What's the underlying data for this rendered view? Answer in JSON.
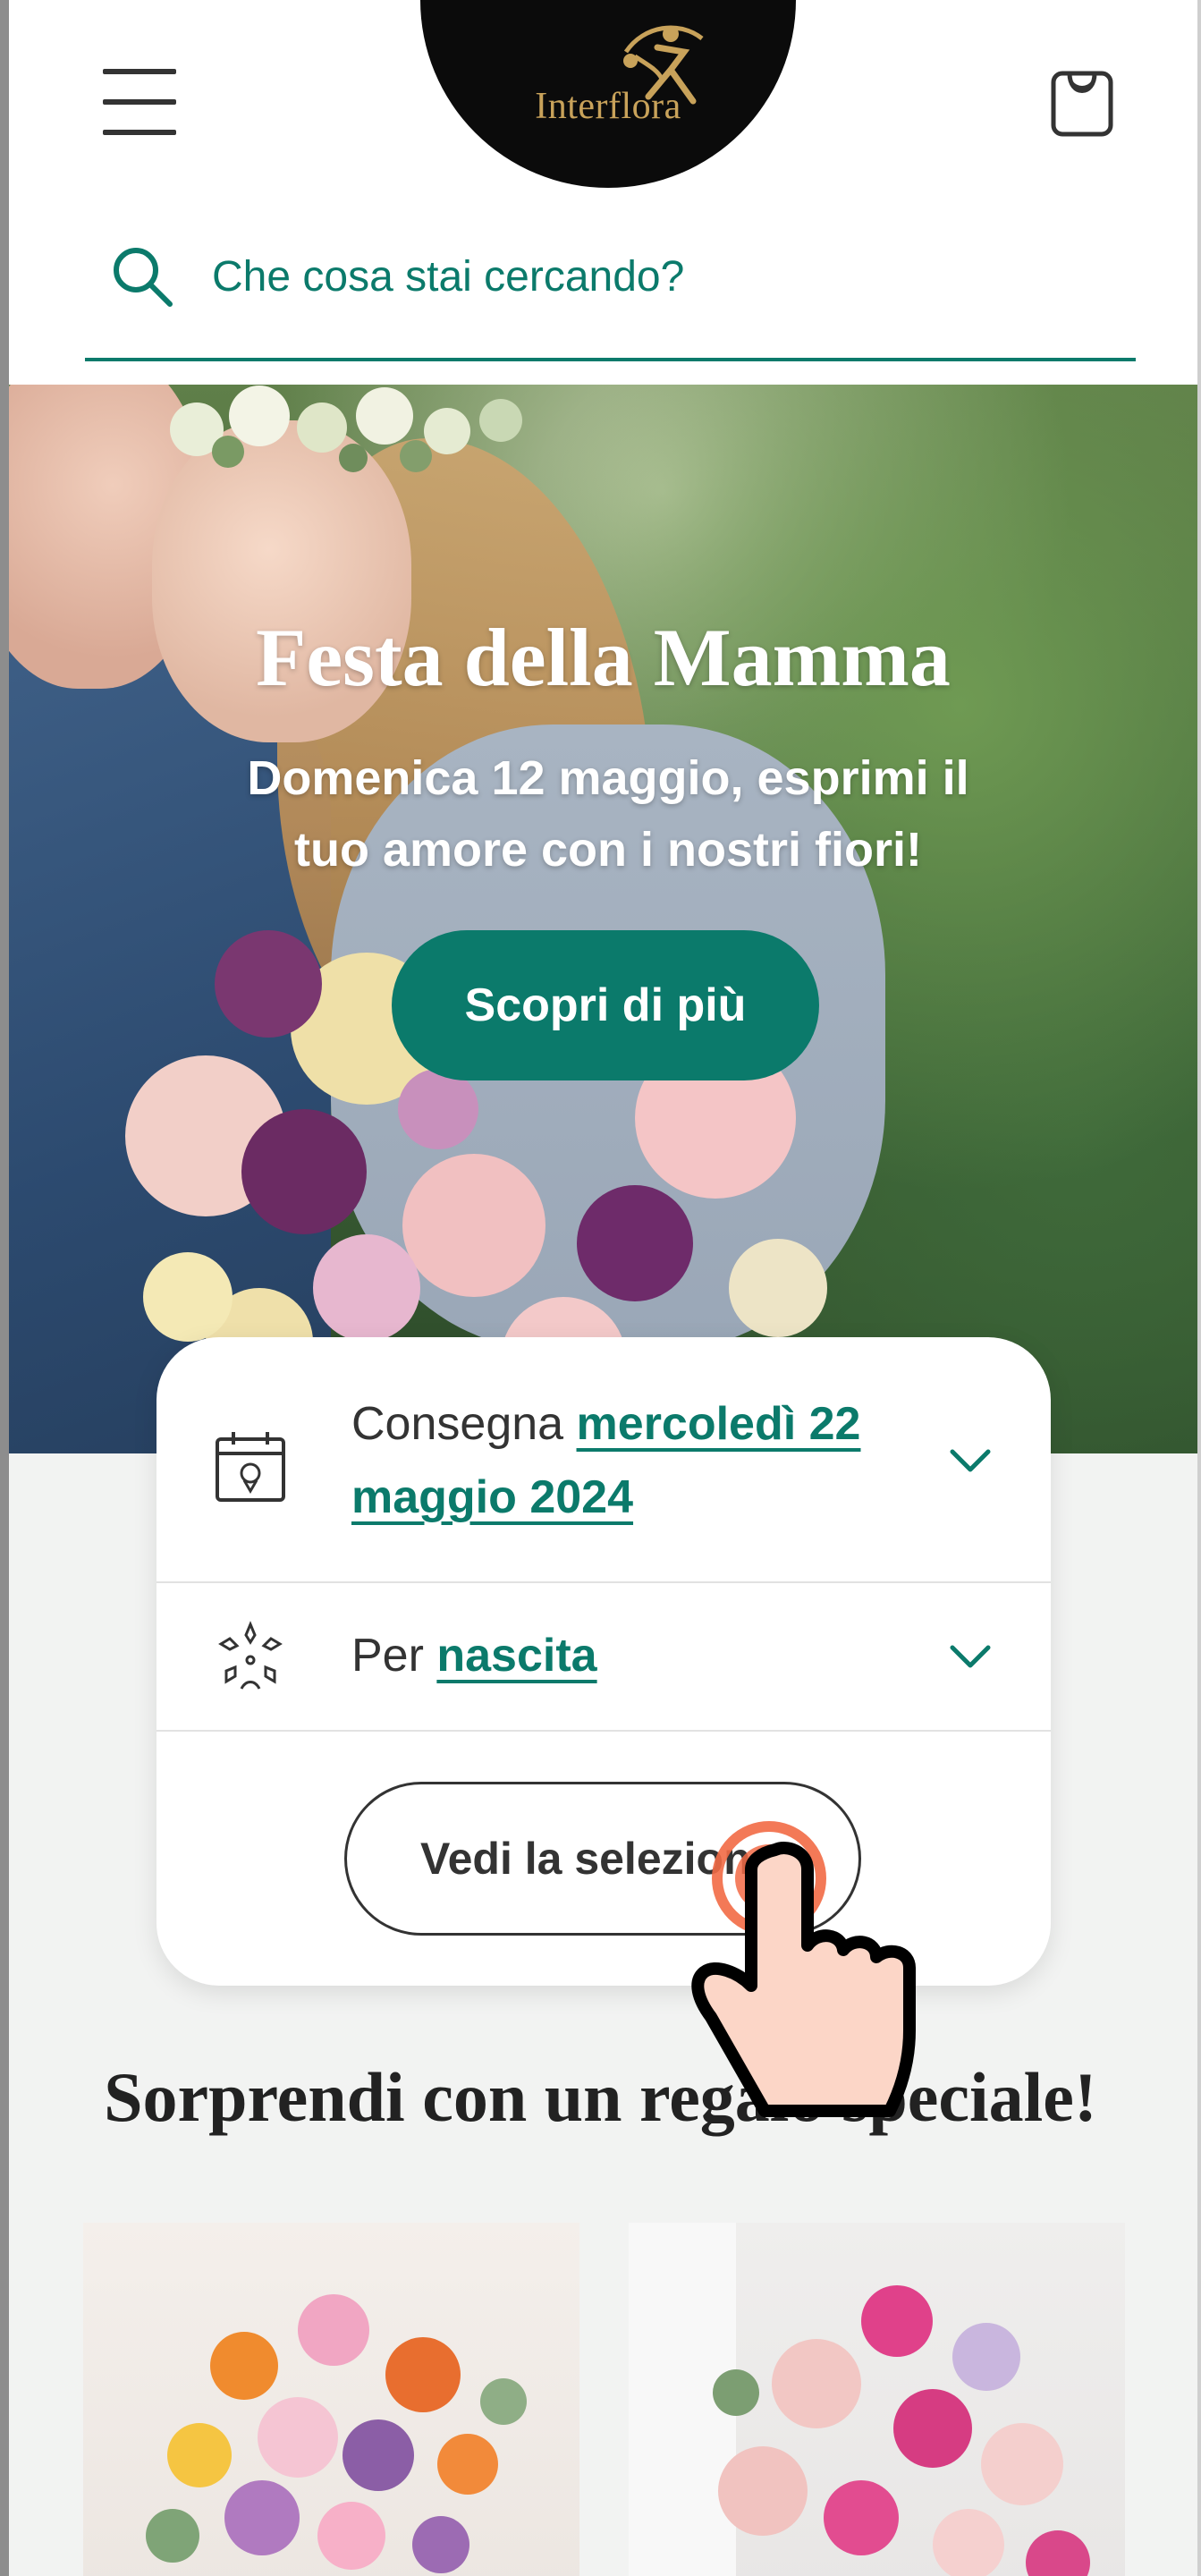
{
  "header": {
    "logo_text": "Interflora",
    "search_placeholder": "Che cosa stai cercando?"
  },
  "hero": {
    "title": "Festa della Mamma",
    "subtitle": "Domenica 12 maggio, esprimi il tuo amore con i nostri fiori!",
    "cta_label": "Scopri di più"
  },
  "delivery_card": {
    "delivery_prefix": "Consegna",
    "delivery_date": "mercoledì 22 maggio 2024",
    "occasion_prefix": "Per",
    "occasion_value": "nascita",
    "selection_button": "Vedi la selezione"
  },
  "section": {
    "title": "Sorprendi con un regalo speciale!"
  },
  "icons": {
    "menu": "hamburger-menu-icon",
    "cart": "shopping-bag-icon",
    "search": "search-icon",
    "calendar": "calendar-icon",
    "occasion": "flower-wreath-icon",
    "chevron": "chevron-down-icon"
  },
  "colors": {
    "brand_teal": "#0b7a6b",
    "logo_gold": "#c8a25a",
    "text_dark": "#333333"
  }
}
